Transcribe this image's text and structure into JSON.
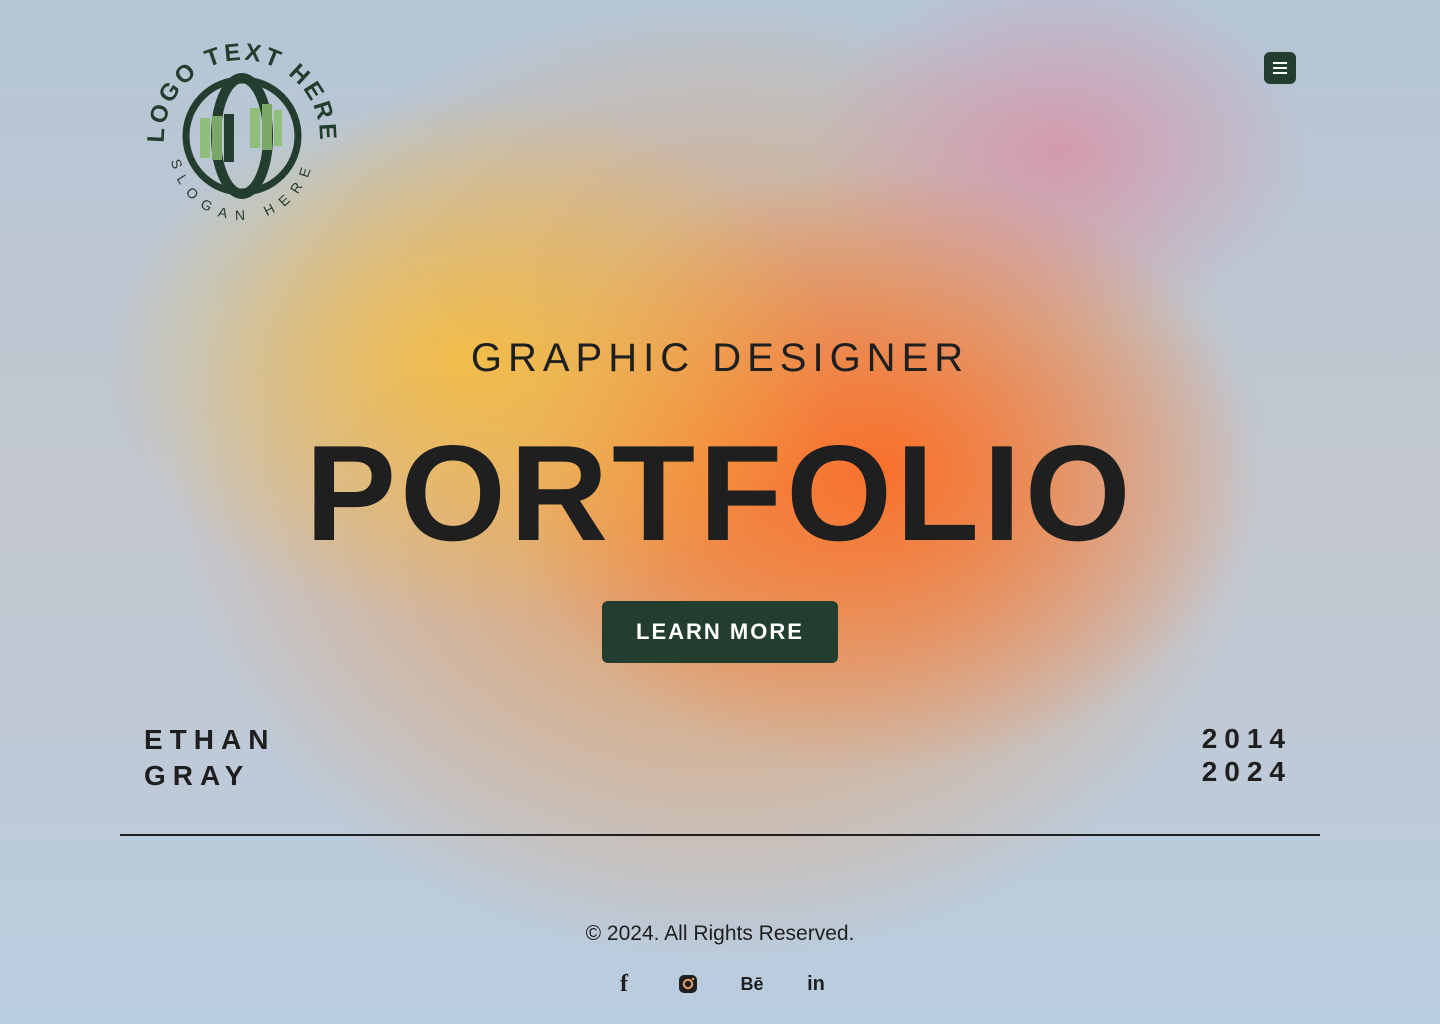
{
  "logo": {
    "text_top": "LOGO TEXT HERE",
    "text_bottom": "SLOGAN HERE",
    "brand_color": "#233d2e",
    "accent_color": "#8fbf7a"
  },
  "header": {
    "menu_icon": "hamburger-icon"
  },
  "hero": {
    "subtitle": "GRAPHIC DESIGNER",
    "title": "PORTFOLIO",
    "cta_label": "LEARN MORE"
  },
  "owner": {
    "first_name": "ETHAN",
    "last_name": "GRAY"
  },
  "period": {
    "start": "2014",
    "end": "2024"
  },
  "footer": {
    "copyright": "© 2024. All Rights Reserved.",
    "socials": [
      {
        "name": "facebook-icon",
        "glyph": "f"
      },
      {
        "name": "instagram-icon",
        "glyph": ""
      },
      {
        "name": "behance-icon",
        "glyph": "Bē"
      },
      {
        "name": "linkedin-icon",
        "glyph": "in"
      }
    ]
  },
  "colors": {
    "button_bg": "#233d2e",
    "text": "#1f1f1f",
    "gradient_orange": "#fa6e28",
    "gradient_yellow": "#f6be3c",
    "gradient_blue": "#b5c6d6"
  }
}
